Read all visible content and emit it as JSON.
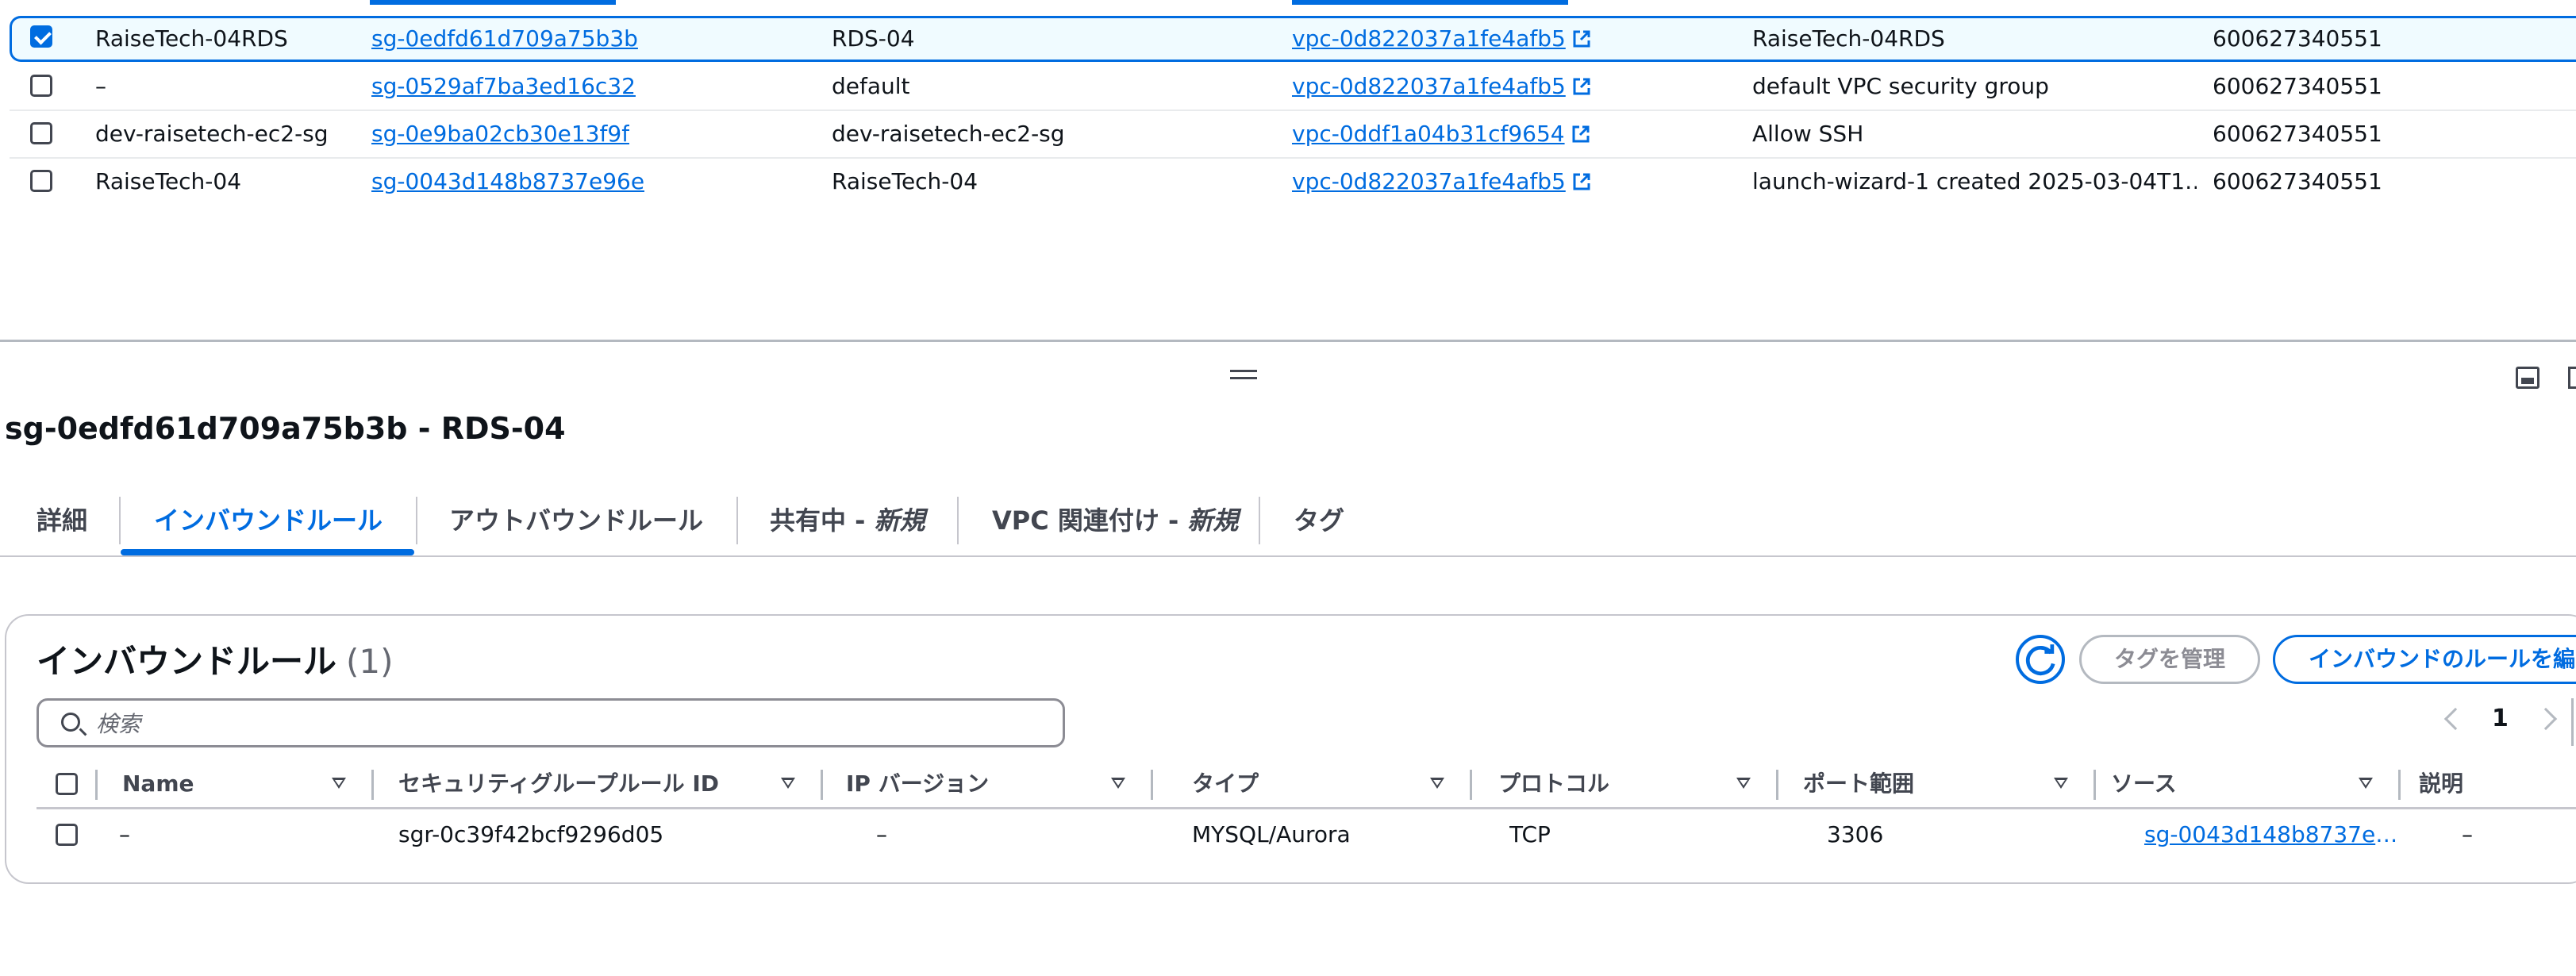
{
  "security_groups": {
    "rows": [
      {
        "name": "RaiseTech-04RDS",
        "group_id": "sg-0edfd61d709a75b3b",
        "group_name": "RDS-04",
        "vpc_id": "vpc-0d822037a1fe4afb5",
        "description": "RaiseTech-04RDS",
        "owner": "600627340551",
        "selected": true
      },
      {
        "name": "–",
        "group_id": "sg-0529af7ba3ed16c32",
        "group_name": "default",
        "vpc_id": "vpc-0d822037a1fe4afb5",
        "description": "default VPC security group",
        "owner": "600627340551",
        "selected": false
      },
      {
        "name": "dev-raisetech-ec2-sg",
        "group_id": "sg-0e9ba02cb30e13f9f",
        "group_name": "dev-raisetech-ec2-sg",
        "vpc_id": "vpc-0ddf1a04b31cf9654",
        "description": "Allow SSH",
        "owner": "600627340551",
        "selected": false
      },
      {
        "name": "RaiseTech-04",
        "group_id": "sg-0043d148b8737e96e",
        "group_name": "RaiseTech-04",
        "vpc_id": "vpc-0d822037a1fe4afb5",
        "description": "launch-wizard-1 created 2025-03-04T1…",
        "owner": "600627340551",
        "selected": false
      }
    ]
  },
  "detail": {
    "title": "sg-0edfd61d709a75b3b - RDS-04",
    "tabs": [
      {
        "label": "詳細"
      },
      {
        "label": "インバウンドルール",
        "active": true
      },
      {
        "label": "アウトバウンドルール"
      },
      {
        "label": "共有中 - ",
        "badge": "新規"
      },
      {
        "label": "VPC 関連付け - ",
        "badge": "新規"
      },
      {
        "label": "タグ"
      }
    ]
  },
  "inbound": {
    "title": "インバウンドルール",
    "count": "(1)",
    "manage_tags_label": "タグを管理",
    "edit_rules_label": "インバウンドのルールを編",
    "search_placeholder": "検索",
    "page": "1",
    "columns": [
      "Name",
      "セキュリティグループルール ID",
      "IP バージョン",
      "タイプ",
      "プロトコル",
      "ポート範囲",
      "ソース",
      "説明"
    ],
    "rows": [
      {
        "name": "–",
        "rule_id": "sgr-0c39f42bcf9296d05",
        "ip_version": "–",
        "type": "MYSQL/Aurora",
        "protocol": "TCP",
        "port_range": "3306",
        "source": "sg-0043d148b8737e96…",
        "description": "–"
      }
    ]
  },
  "colors": {
    "accent": "#006ce0",
    "text": "#0f141a",
    "muted": "#656871",
    "border": "#c6c6cd"
  },
  "icons": [
    "checkbox-icon",
    "external-link-icon",
    "resize-handle-icon",
    "panel-toggle-icon",
    "refresh-icon",
    "search-icon",
    "sort-icon",
    "chevron-left-icon",
    "chevron-right-icon"
  ]
}
